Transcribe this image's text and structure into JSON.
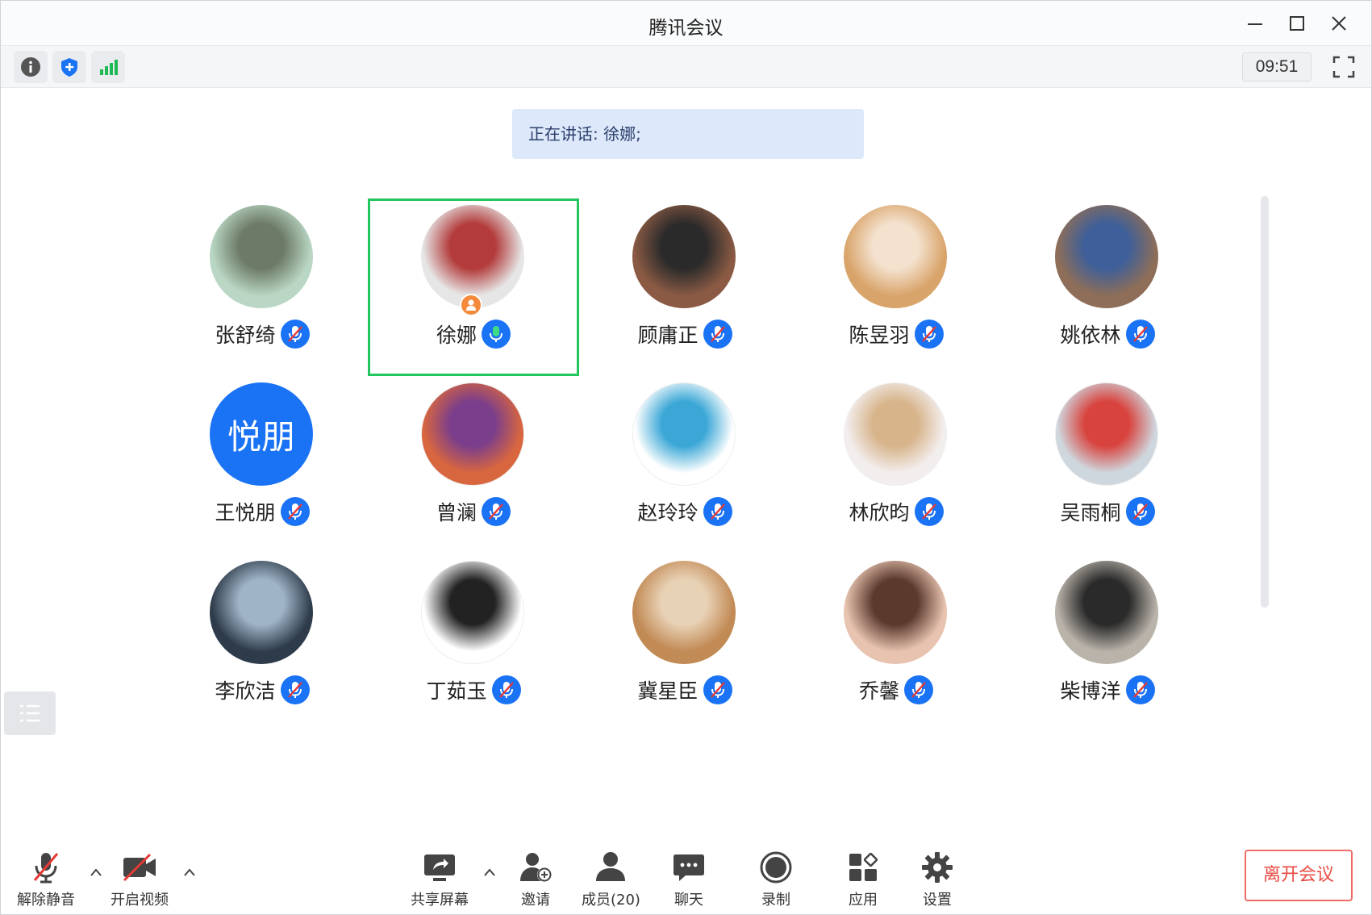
{
  "window": {
    "title": "腾讯会议",
    "clock": "09:51"
  },
  "icons": {
    "info": "info-icon",
    "security": "shield-icon",
    "signal": "signal-icon",
    "fullscreen": "fullscreen-icon"
  },
  "speaking": {
    "text": "正在讲话: 徐娜;"
  },
  "participants": [
    {
      "name": "张舒绮",
      "avatar": "photo",
      "mic": "muted"
    },
    {
      "name": "徐娜",
      "avatar": "cartoon-girl",
      "mic": "on",
      "active": true,
      "host": true
    },
    {
      "name": "顾庸正",
      "avatar": "photo",
      "mic": "muted"
    },
    {
      "name": "陈昱羽",
      "avatar": "dog",
      "mic": "muted"
    },
    {
      "name": "姚依林",
      "avatar": "photo",
      "mic": "muted"
    },
    {
      "name": "王悦朋",
      "avatar": "text",
      "avatar_text": "悦朋",
      "mic": "muted"
    },
    {
      "name": "曾澜",
      "avatar": "cartoon",
      "mic": "muted"
    },
    {
      "name": "赵玲玲",
      "avatar": "cartoon",
      "mic": "muted"
    },
    {
      "name": "林欣昀",
      "avatar": "cartoon",
      "mic": "muted"
    },
    {
      "name": "吴雨桐",
      "avatar": "cartoon",
      "mic": "muted"
    },
    {
      "name": "李欣洁",
      "avatar": "anime",
      "mic": "muted"
    },
    {
      "name": "丁茹玉",
      "avatar": "sketch",
      "mic": "muted"
    },
    {
      "name": "冀星臣",
      "avatar": "cat",
      "mic": "muted"
    },
    {
      "name": "乔馨",
      "avatar": "photo",
      "mic": "muted"
    },
    {
      "name": "柴博洋",
      "avatar": "photo",
      "mic": "muted"
    }
  ],
  "toolbar": {
    "unmute": "解除静音",
    "start_video": "开启视频",
    "share_screen": "共享屏幕",
    "invite": "邀请",
    "members": "成员(20)",
    "chat": "聊天",
    "record": "录制",
    "apps": "应用",
    "settings": "设置",
    "leave": "离开会议"
  },
  "colors": {
    "accent": "#1a73f5",
    "active_border": "#22c55e",
    "leave": "#ea4a43",
    "banner": "#dde8fb"
  }
}
